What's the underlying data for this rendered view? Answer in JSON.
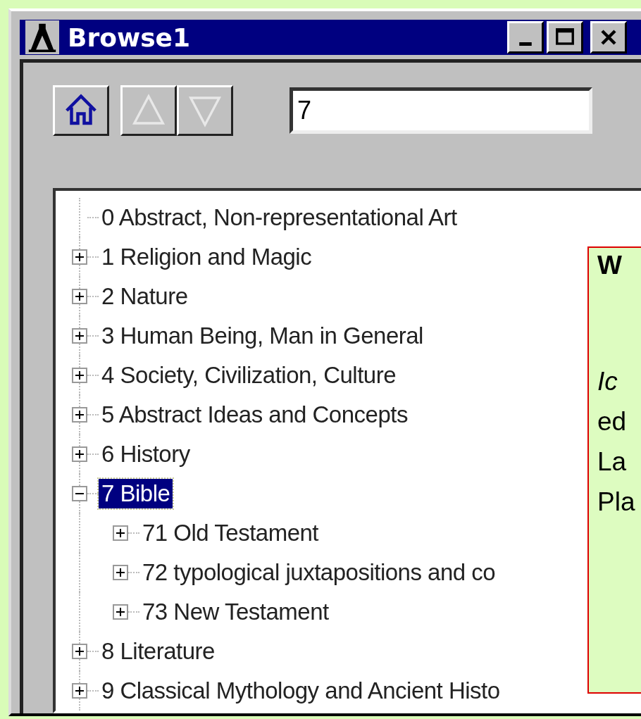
{
  "window": {
    "title": "Browse1"
  },
  "toolbar": {
    "buttons": [
      {
        "kind": "home",
        "disabled": false
      },
      {
        "kind": "up",
        "disabled": true
      },
      {
        "kind": "down",
        "disabled": true
      }
    ],
    "search": {
      "value": "7"
    }
  },
  "tree": [
    {
      "label": "0 Abstract, Non-representational Art",
      "selected": false
    },
    {
      "label": "1 Religion and Magic",
      "expanded": false,
      "selected": false
    },
    {
      "label": "2 Nature",
      "expanded": false,
      "selected": false
    },
    {
      "label": "3 Human Being, Man in General",
      "expanded": false,
      "selected": false
    },
    {
      "label": "4 Society, Civilization, Culture",
      "expanded": false,
      "selected": false
    },
    {
      "label": "5 Abstract Ideas and Concepts",
      "expanded": false,
      "selected": false
    },
    {
      "label": "6 History",
      "expanded": false,
      "selected": false
    },
    {
      "label": "7 Bible",
      "expanded": true,
      "selected": true,
      "children": [
        {
          "label": "71 Old Testament",
          "expanded": false,
          "selected": false
        },
        {
          "label": "72 typological juxtapositions and co",
          "expanded": false,
          "selected": false
        },
        {
          "label": "73 New Testament",
          "expanded": false,
          "selected": false
        }
      ]
    },
    {
      "label": "8 Literature",
      "expanded": false,
      "selected": false
    },
    {
      "label": "9 Classical Mythology and Ancient Histo",
      "expanded": false,
      "selected": false
    }
  ],
  "overlay": {
    "lines": [
      {
        "text": "W"
      },
      {
        "text": "Ic"
      },
      {
        "text": "ed"
      },
      {
        "text": "La"
      },
      {
        "text": "Pla"
      }
    ]
  }
}
